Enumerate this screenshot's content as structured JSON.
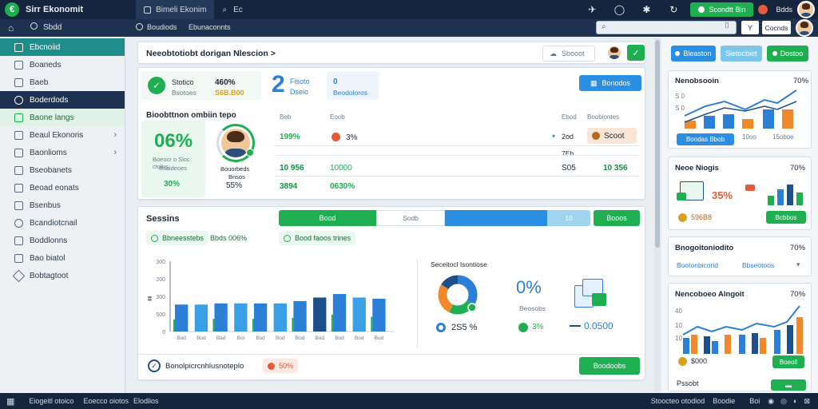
{
  "app": {
    "title": "Sirr Ekonomit",
    "tabs": [
      {
        "label": "Bimeli Ekonim"
      },
      {
        "label": "Ec"
      }
    ],
    "account_button": "Scondtt Bin",
    "user_label": "Bdds"
  },
  "nav": {
    "home_label": "Sbdd",
    "breadcrumb_1": "Boudiods",
    "breadcrumb_2": "Ebunaconnts",
    "search_value": "",
    "btn_y": "Y",
    "btn_secondary": "Cocnds"
  },
  "sidebar": {
    "items": [
      {
        "label": "Ebcnoiid"
      },
      {
        "label": "Boaneds"
      },
      {
        "label": "Baeb"
      },
      {
        "label": "Boderdods"
      },
      {
        "label": "Baone langs"
      },
      {
        "label": "Beaul Ekonoris"
      },
      {
        "label": "Baonlioms"
      },
      {
        "label": "Bseobanets"
      },
      {
        "label": "Beoad eonats"
      },
      {
        "label": "Bsenbus"
      },
      {
        "label": "Bcandiotcnail"
      },
      {
        "label": "Boddlonns"
      },
      {
        "label": "Bao biatol"
      },
      {
        "label": "Bobtagtoot"
      }
    ]
  },
  "header_card": {
    "title": "Neeobtotiobt dorigan Nlescion >",
    "button_label": "Sbooot"
  },
  "summary_card": {
    "stat1_label": "Stotico",
    "stat1_sub": "Bsotoes",
    "stat2_value": "460%",
    "stat2_sub": "S6B.B00",
    "big_number": "2",
    "stat3_label": "Fisoto",
    "stat3_sub": "Dseio",
    "stat4_value": "0",
    "stat4_sub": "Beodoloros",
    "action_label": "Bonodos",
    "section_title": "Bioobttnon ombiin tepo",
    "big_percent": "06%",
    "percent_caption_1": "Boeocr o Sloc ctolns",
    "percent_caption_2": "Bsaideoes",
    "percent_footer": "30%",
    "avatar_caption_1": "Bouorbeds",
    "avatar_caption_2": "Bnsos",
    "avatar_percent": "55%",
    "table_headers": [
      "Beb",
      "Eoob",
      "Ebod",
      "Boobiontes"
    ],
    "rows": [
      {
        "c1": "199%",
        "c2": "3%",
        "c3": "2od",
        "c4": "Scoot"
      },
      {
        "c1": "",
        "c2": "",
        "c3": "7Eb",
        "c4": ""
      },
      {
        "c1": "10 956",
        "c2": "10000",
        "c3": "S05",
        "c4": "10 356"
      },
      {
        "c1": "3894",
        "c2": "0630%",
        "c3": "",
        "c4": ""
      }
    ]
  },
  "sessions_card": {
    "title": "Sessins",
    "segments": [
      {
        "label": "Bood"
      },
      {
        "label": "Sodb"
      },
      {
        "label": ""
      },
      {
        "label": "10"
      }
    ],
    "action_label": "Booos",
    "filter_chip": "Bbneesstebs",
    "filter_text": "Bbds 006%",
    "chip2": "Bood faoos trines",
    "chart_title": "Seceitocl Isontiose",
    "donut_percent": "25%",
    "donut_value": "2S5 %",
    "donut_secondary": "3%",
    "ring_value": "0%",
    "ring_caption": "Beosobs",
    "ring_sub": "0.0500",
    "footer_text": "Bonolpicrcnhlusnoteplo",
    "footer_badge": "50%",
    "footer_button": "Boodoobs"
  },
  "chart_data": {
    "type": "bar",
    "categories": [
      "Bod",
      "Bod",
      "Bad",
      "Bol",
      "Bsd",
      "Bod",
      "Bod",
      "Bod",
      "Bod",
      "Bod",
      "Bod"
    ],
    "series": [
      {
        "values": [
          115,
          115,
          120,
          120,
          120,
          120,
          130,
          145,
          160,
          145,
          140
        ]
      }
    ],
    "yticks": [
      "300",
      "200",
      "300",
      "500",
      "0"
    ],
    "ylim": [
      0,
      300
    ],
    "colors": [
      "#2c7fd6",
      "#1fae52"
    ]
  },
  "right_panel": {
    "card1": {
      "tab1": "Bleaston",
      "tab2": "Sietocbiet",
      "tab3": "Dostoo"
    },
    "card2": {
      "title": "Nenobsooin",
      "percent": "70%",
      "row1": "S 0",
      "row2": "S 0",
      "btn": "Boodas Bbob",
      "labels": [
        "10oo",
        "15oboe"
      ]
    },
    "card3": {
      "title": "Neoe Niogis",
      "percent": "70%",
      "value": "35%",
      "badge_value": "596B8",
      "btn": "Bcbbos"
    },
    "card4": {
      "title": "Bnogoitoniodito",
      "percent": "70%",
      "sub1": "Bootonbicorid",
      "sub2": "Bbseotoos"
    },
    "card5": {
      "title": "Nencoboeo Alngoit",
      "percent": "70%",
      "y1": "40",
      "y2": "10",
      "y3": "10",
      "footer": "$000",
      "btn": "Boeoll",
      "bottom": "Pssobt"
    }
  },
  "status": {
    "left_1": "Eiogeitl otoico",
    "left_2": "Eoecco oiotos",
    "left_3": "Elodlios",
    "right_1": "Stoocteo otodiod",
    "right_2": "Boodie",
    "right_3": "Boi"
  }
}
